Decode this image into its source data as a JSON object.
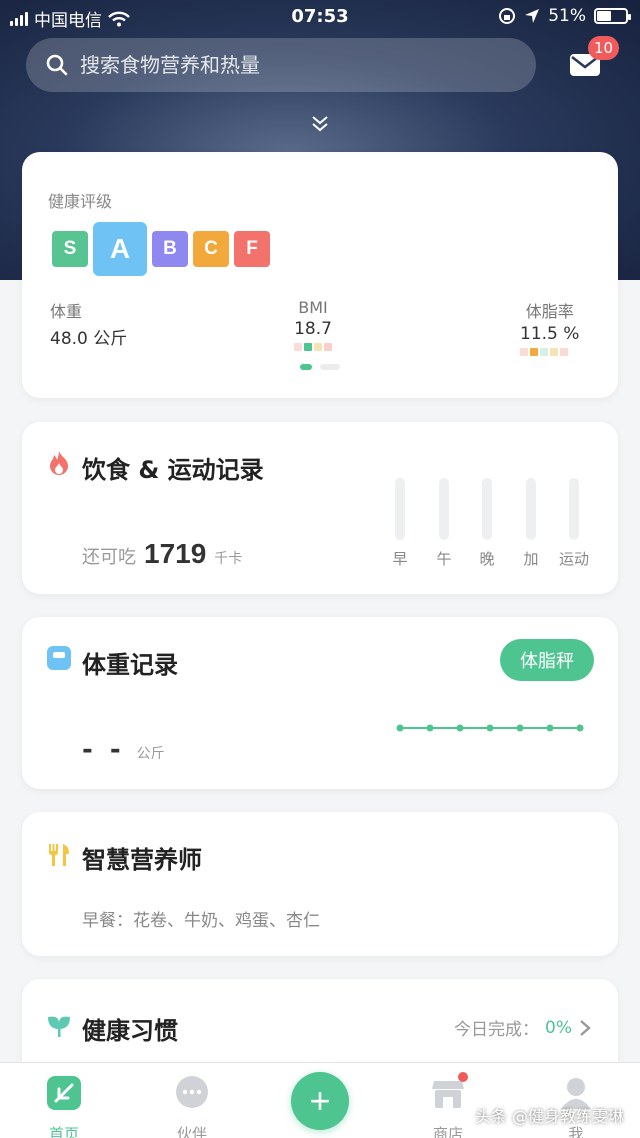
{
  "status_bar": {
    "carrier": "中国电信",
    "time": "07:53",
    "battery": "51%",
    "battery_level": 0.51
  },
  "search": {
    "placeholder": "搜索食物营养和热量"
  },
  "mail": {
    "badge": "10"
  },
  "health_card": {
    "title": "健康评级",
    "grades": [
      {
        "label": "S",
        "color": "#57c492"
      },
      {
        "label": "A",
        "color": "#6ec3f4",
        "active": true
      },
      {
        "label": "B",
        "color": "#8f88f0"
      },
      {
        "label": "C",
        "color": "#f2a83b"
      },
      {
        "label": "F",
        "color": "#f3726b"
      }
    ],
    "weight": {
      "label": "体重",
      "value": "48.0 公斤"
    },
    "bmi": {
      "label": "BMI",
      "value": "18.7"
    },
    "body_fat": {
      "label": "体脂率",
      "value": "11.5 %"
    }
  },
  "diet_card": {
    "title": "饮食 & 运动记录",
    "remaining_label": "还可吃",
    "remaining_value": "1719",
    "remaining_unit": "千卡",
    "meals": [
      "早",
      "午",
      "晚",
      "加",
      "运动"
    ]
  },
  "weight_card": {
    "title": "体重记录",
    "scale_button": "体脂秤",
    "value": "- -",
    "unit": "公斤"
  },
  "nutrition_card": {
    "title": "智慧营养师",
    "menu": "早餐：花卷、牛奶、鸡蛋、杏仁"
  },
  "habit_card": {
    "title": "健康习惯",
    "status_label": "今日完成：",
    "status_value": "0%"
  },
  "tabbar": {
    "home": "首页",
    "partner": "伙伴",
    "add": "+",
    "shop": "商店",
    "me": "我"
  },
  "watermark": "头条 @健身教练雯琳",
  "colors": {
    "accent": "#4ec491",
    "badge": "#f25b5b"
  }
}
